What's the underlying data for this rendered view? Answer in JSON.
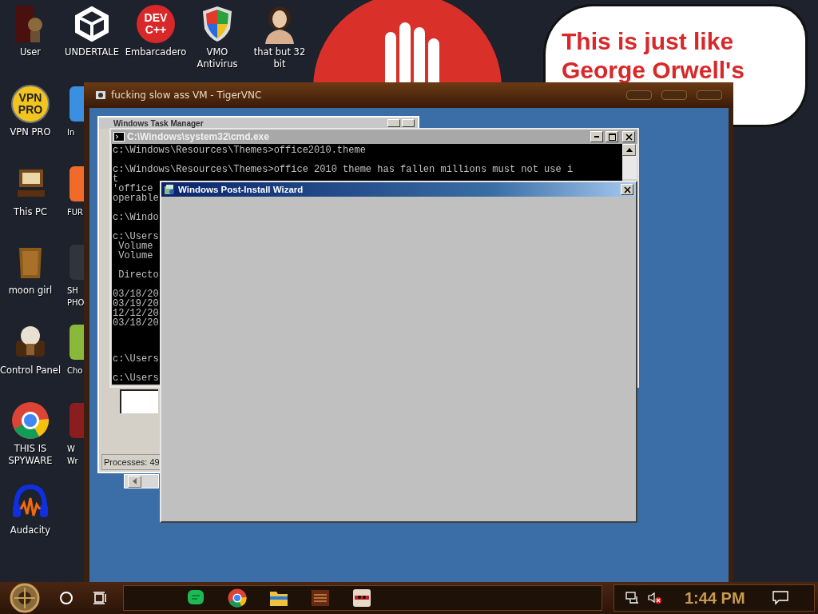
{
  "desktop_icons": [
    {
      "kind": "door",
      "label": "User"
    },
    {
      "kind": "cube",
      "label": "UNDERTALE"
    },
    {
      "kind": "logo",
      "label": "Embarcadero",
      "logo_text": [
        "DEV",
        "C++"
      ]
    },
    {
      "kind": "shield",
      "label": "VMO Antivirus"
    },
    {
      "kind": "portrait",
      "label": "that but 32 bit"
    },
    {
      "kind": "logo",
      "label": "VPN PRO",
      "logo_text": [
        "VPN",
        "PRO"
      ]
    },
    {
      "kind": "computer",
      "label": "This PC"
    },
    {
      "kind": "crate",
      "label": "moon girl"
    },
    {
      "kind": "bulb",
      "label": "Control Panel"
    },
    {
      "kind": "browser",
      "label": "THIS IS SPYWARE"
    },
    {
      "kind": "headphones",
      "label": "Audacity"
    }
  ],
  "partly_hidden_icons": [
    {
      "label": "In"
    },
    {
      "label": "FUR"
    },
    {
      "label": "SH PHO"
    },
    {
      "label": "Cho"
    },
    {
      "label": "W Wr"
    }
  ],
  "speech_bubble": {
    "text": "This is just like George Orwell's"
  },
  "vnc_window": {
    "title": "fucking slow ass VM - TigerVNC"
  },
  "task_manager": {
    "title": "Windows Task Manager",
    "status": "Processes: 49"
  },
  "cmd_window": {
    "title": "C:\\Windows\\system32\\cmd.exe",
    "paragraphs": [
      [
        "c:\\Windows\\Resources\\Themes>office2010.theme"
      ],
      [
        "c:\\Windows\\Resources\\Themes>office 2010 theme has fallen millions must not use i",
        "t",
        "'office",
        "operable"
      ],
      [
        "c:\\Windo"
      ],
      [
        "c:\\Users",
        " Volume",
        " Volume"
      ],
      [
        " Directo"
      ],
      [
        "03/18/20",
        "03/19/20",
        "12/12/20",
        "03/18/20"
      ],
      [
        "c:\\Users"
      ],
      [
        "c:\\Users"
      ]
    ]
  },
  "wizard": {
    "title": "Windows Post-Install Wizard"
  },
  "taskbar": {
    "apps": [
      {
        "kind": "chat"
      },
      {
        "kind": "browser"
      },
      {
        "kind": "folder"
      },
      {
        "kind": "archive"
      },
      {
        "kind": "mask"
      }
    ],
    "volume_muted": true,
    "clock": "1:44 PM"
  }
}
